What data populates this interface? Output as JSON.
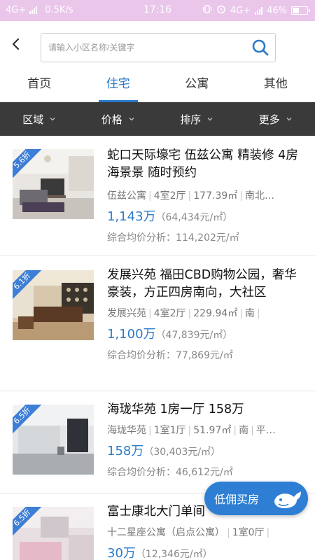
{
  "status_bar": {
    "network": "4G+",
    "speed": "0.5K/s",
    "time": "17:16",
    "right_network": "4G+",
    "battery": "46%",
    "battery_level": 0.46
  },
  "search": {
    "placeholder": "请输入小区名称/关键字"
  },
  "tabs": [
    {
      "label": "首页"
    },
    {
      "label": "住宅"
    },
    {
      "label": "公寓"
    },
    {
      "label": "其他"
    }
  ],
  "filters": [
    {
      "label": "区域"
    },
    {
      "label": "价格"
    },
    {
      "label": "排序"
    },
    {
      "label": "更多"
    }
  ],
  "listings": [
    {
      "discount": "5.6折",
      "title": "蛇口天际壕宅 伍兹公寓 精装修 4房海景景 随时预约",
      "community": "伍兹公寓",
      "layout": "4室2厅",
      "area": "177.39㎡",
      "orientation": "南北…",
      "total_price": "1,143万",
      "unit_price": "（64,434元/㎡）",
      "avg_label": "综合均价分析：",
      "avg_value": "114,202元/㎡"
    },
    {
      "discount": "6.1折",
      "title": "发展兴苑 福田CBD购物公园，奢华豪装，方正四房南向，大社区",
      "community": "发展兴苑",
      "layout": "4室2厅",
      "area": "229.94㎡",
      "orientation": "南",
      "total_price": "1,100万",
      "unit_price": "（47,839元/㎡）",
      "avg_label": "综合均价分析：",
      "avg_value": "77,869元/㎡"
    },
    {
      "discount": "6.5折",
      "title": "海珑华苑 1房一厅 158万",
      "community": "海珑华苑",
      "layout": "1室1厅",
      "area": "51.97㎡",
      "orientation": "南",
      "extra": "平…",
      "total_price": "158万",
      "unit_price": "（30,403元/㎡）",
      "avg_label": "综合均价分析：",
      "avg_value": "46,612元/㎡"
    },
    {
      "discount": "6.5折",
      "title": "富士康北大门单间",
      "community": "十二星座公寓（启点公寓）",
      "layout": "1室0厅",
      "total_price": "30万",
      "unit_price": "（12,346元/㎡）"
    }
  ],
  "fab": {
    "label": "低佣买房"
  },
  "colors": {
    "accent": "#2b7bc9",
    "filter_bar": "#3a3a3a",
    "status_bar": "#e9c6ea",
    "discount_badge": "#3d7ed6"
  }
}
